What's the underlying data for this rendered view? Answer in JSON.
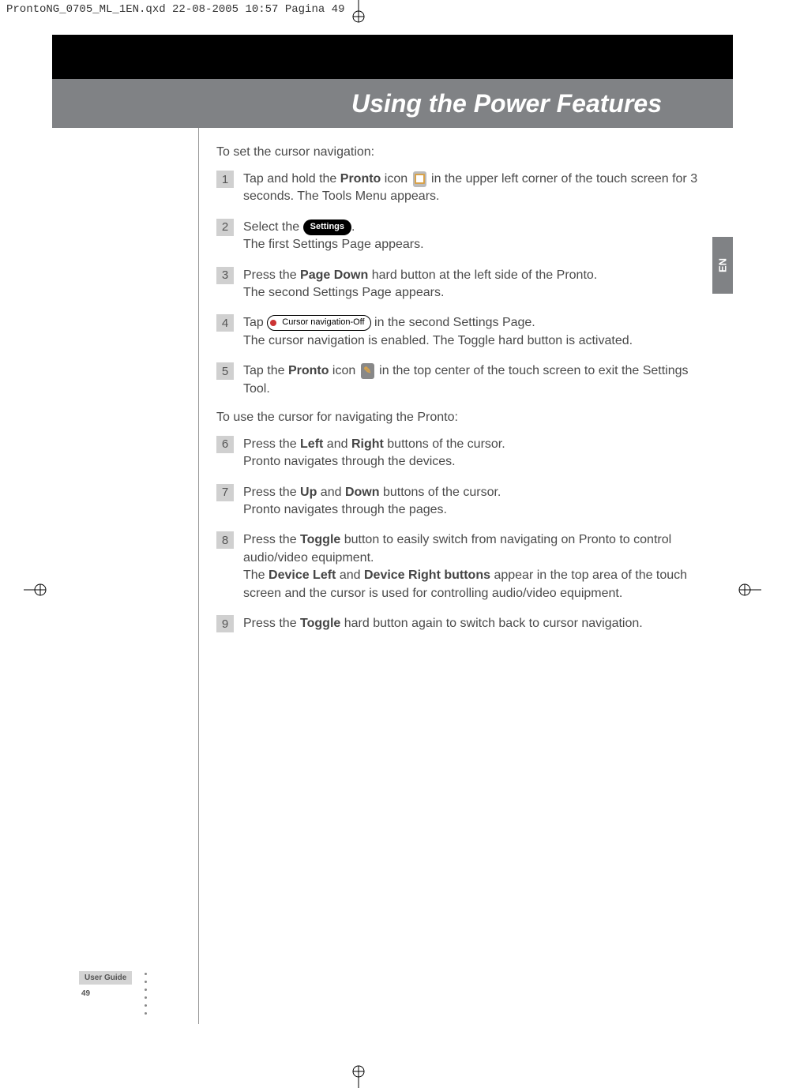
{
  "page_header": "ProntoNG_0705_ML_1EN.qxd  22-08-2005  10:57  Pagina 49",
  "chapter_title": "Using the Power Features",
  "side_tab": "EN",
  "intro1": "To set the cursor navigation:",
  "steps1": {
    "1": {
      "pre": "Tap and hold the ",
      "b1": "Pronto",
      "mid": " icon ",
      "icon": "pronto-icon",
      "post": " in the upper left corner of the touch screen for 3 seconds.",
      "sub": " The Tools Menu appears."
    },
    "2": {
      "pre": "Select the ",
      "pill": "Settings",
      "post": ".",
      "sub": "The first Settings Page appears."
    },
    "3": {
      "pre": "Press the ",
      "b1": "Page Down",
      "post": " hard button at the left side of the Pronto.",
      "sub": "The second Settings Page appears."
    },
    "4": {
      "pre": "Tap ",
      "pill": "Cursor navigation-Off",
      "post": " in the second Settings Page.",
      "sub": "The cursor navigation is enabled. The Toggle hard button is activated."
    },
    "5": {
      "pre": "Tap the ",
      "b1": "Pronto",
      "mid": " icon ",
      "icon": "pronto-icon-tool",
      "post": " in the top center of the touch screen to exit the Settings Tool."
    }
  },
  "intro2": "To use the cursor for navigating the Pronto:",
  "steps2": {
    "6": {
      "pre": "Press the ",
      "b1": "Left",
      "mid1": " and ",
      "b2": "Right",
      "post": " buttons of the cursor.",
      "sub": "Pronto navigates through the devices."
    },
    "7": {
      "pre": "Press the ",
      "b1": "Up",
      "mid1": " and ",
      "b2": "Down",
      "post": " buttons of the cursor.",
      "sub": "Pronto navigates through the pages."
    },
    "8": {
      "pre": "Press the ",
      "b1": "Toggle",
      "post": " button to easily switch from navigating on Pronto to control audio/video equipment.",
      "sub_pre": "The ",
      "sub_b1": "Device Left",
      "sub_mid": " and ",
      "sub_b2": "Device Right buttons",
      "sub_post": " appear in the top area of the touch screen and the cursor is used for controlling audio/video equipment."
    },
    "9": {
      "pre": "Press the ",
      "b1": "Toggle",
      "post": " hard button again to switch back to cursor navigation."
    }
  },
  "footer": {
    "label": "User Guide",
    "page": "49"
  }
}
